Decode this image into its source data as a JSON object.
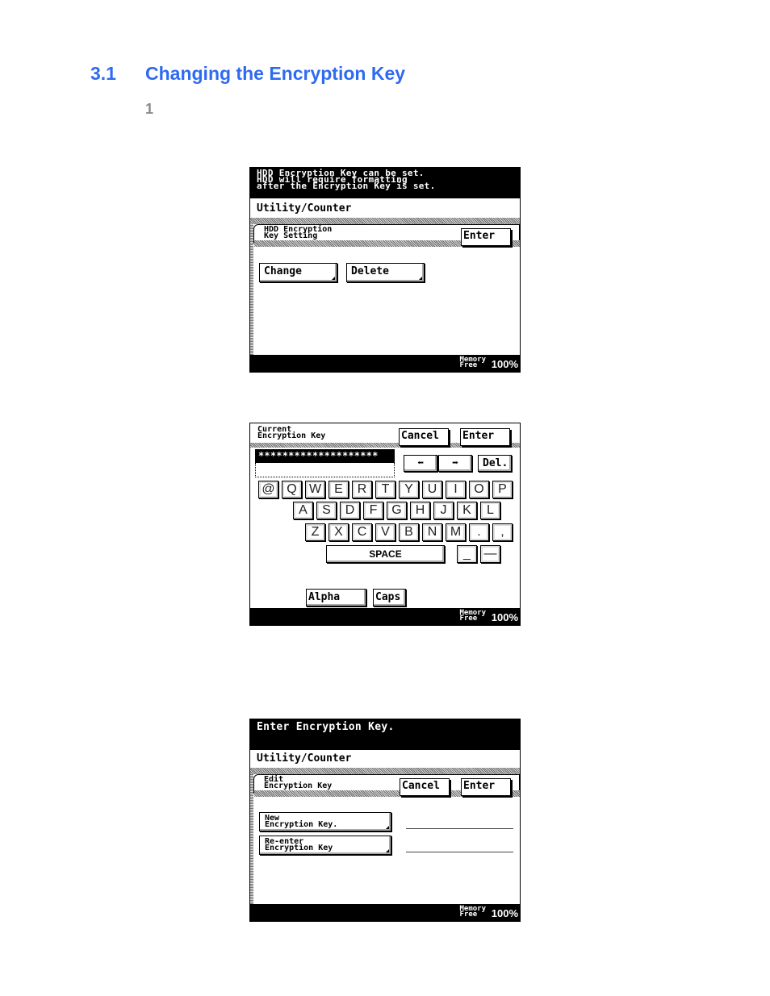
{
  "section": {
    "number": "3.1",
    "title": "Changing the Encryption Key"
  },
  "step": "1",
  "screen1": {
    "message": "HDD Encryption Key can be set.\nHDD will require formatting\nafter the Encryption Key is set.",
    "path": "Utility/Counter",
    "tab": "HDD Encryption\nKey Setting",
    "enter": "Enter",
    "change": "Change",
    "delete": "Delete",
    "memory_label": "Memory\nFree",
    "memory_value": "100%"
  },
  "screen2": {
    "tab": "Current\nEncryption Key",
    "cancel": "Cancel",
    "enter": "Enter",
    "input_value": "********************",
    "left_arrow": "⬅",
    "right_arrow": "➡",
    "del": "Del.",
    "rows": [
      [
        "@",
        "Q",
        "W",
        "E",
        "R",
        "T",
        "Y",
        "U",
        "I",
        "O",
        "P"
      ],
      [
        "A",
        "S",
        "D",
        "F",
        "G",
        "H",
        "J",
        "K",
        "L"
      ],
      [
        "Z",
        "X",
        "C",
        "V",
        "B",
        "N",
        "M",
        ".",
        ","
      ]
    ],
    "space": "SPACE",
    "underscore": "_",
    "dash": "—",
    "alpha": "Alpha",
    "caps": "Caps",
    "memory_label": "Memory\nFree",
    "memory_value": "100%"
  },
  "screen3": {
    "message": "Enter Encryption Key.",
    "path": "Utility/Counter",
    "tab": "Edit\nEncryption Key",
    "cancel": "Cancel",
    "enter": "Enter",
    "new_key": "New\nEncryption Key.",
    "reenter_key": "Re-enter\nEncryption Key",
    "new_key_value": "",
    "reenter_key_value": "",
    "memory_label": "Memory\nFree",
    "memory_value": "100%"
  }
}
